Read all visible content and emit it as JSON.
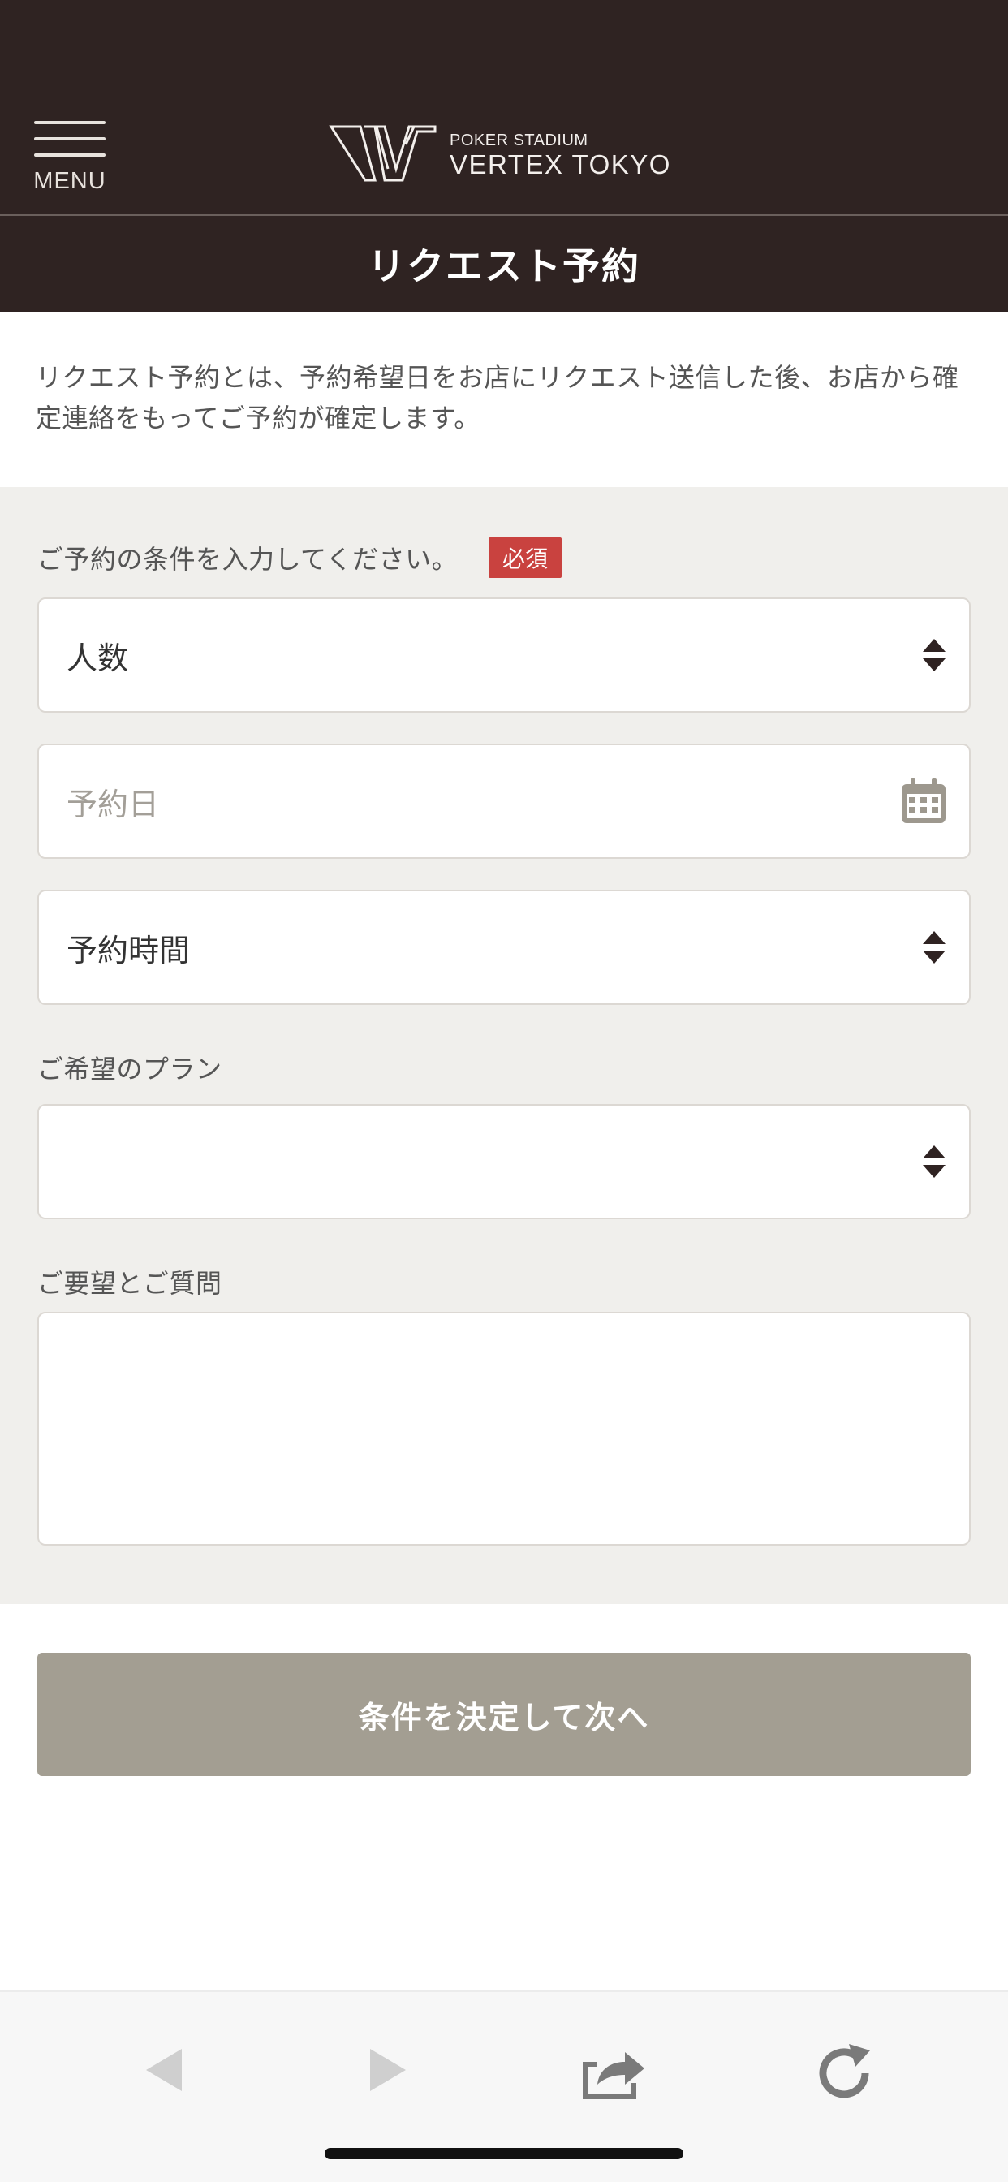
{
  "header": {
    "menu_label": "MENU",
    "logo_small": "POKER STADIUM",
    "logo_big": "VERTEX TOKYO",
    "page_title": "リクエスト予約"
  },
  "intro": {
    "text": "リクエスト予約とは、予約希望日をお店にリクエスト送信した後、お店から確定連絡をもってご予約が確定します。"
  },
  "form": {
    "conditions_label": "ご予約の条件を入力してください。",
    "required_badge": "必須",
    "guests": {
      "value": "人数"
    },
    "date": {
      "placeholder": "予約日"
    },
    "time": {
      "value": "予約時間"
    },
    "plan_label": "ご希望のプラン",
    "plan": {
      "value": ""
    },
    "requests_label": "ご要望とご質問",
    "requests": {
      "value": ""
    },
    "submit_label": "条件を決定して次へ"
  },
  "colors": {
    "header_bg": "#2f2322",
    "form_bg": "#f0efec",
    "required": "#c9423f",
    "button": "#a39e92"
  },
  "toolbar": {
    "icons": [
      "back-icon",
      "forward-icon",
      "share-icon",
      "reload-icon"
    ]
  }
}
